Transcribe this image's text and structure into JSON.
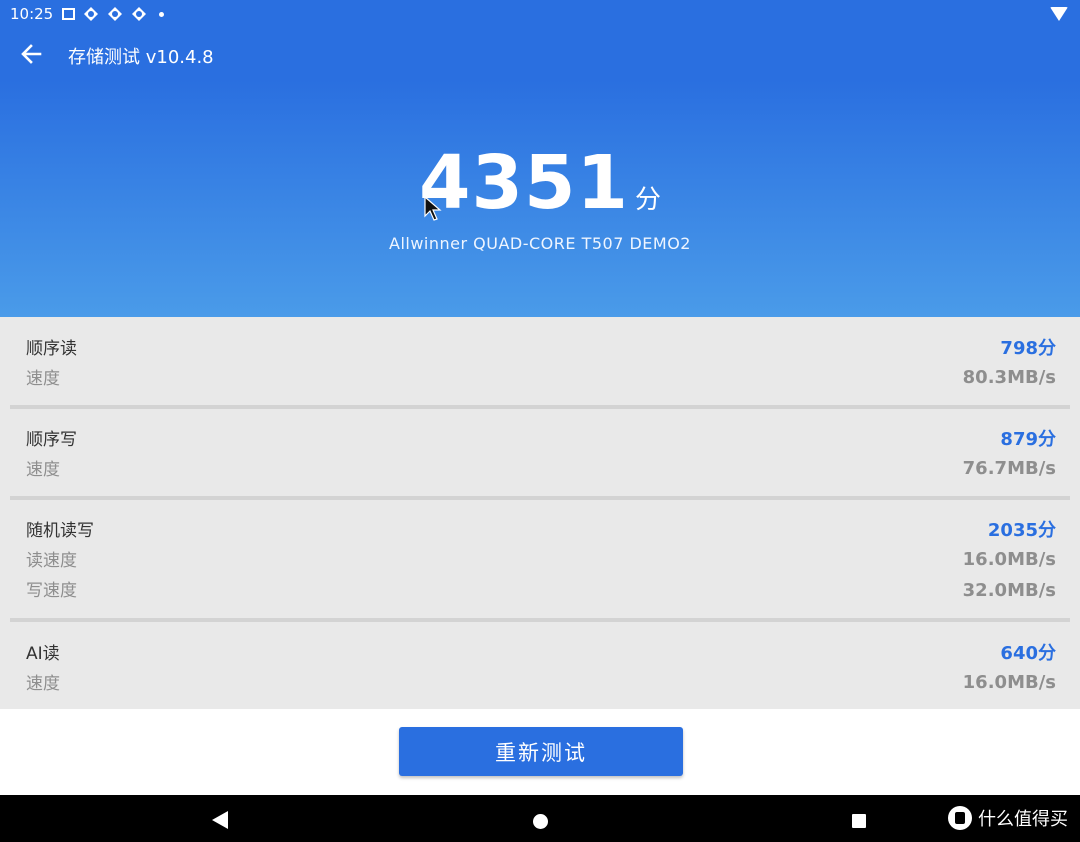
{
  "status": {
    "time": "10:25",
    "icons": [
      "image-icon",
      "sync-icon",
      "sync-icon",
      "sync-icon",
      "dot-icon"
    ],
    "wifi_icon": "wifi-icon"
  },
  "app_bar": {
    "title": "存储测试 v10.4.8",
    "back_icon": "arrow-left-icon"
  },
  "hero": {
    "score": "4351",
    "score_unit": "分",
    "device": "Allwinner QUAD-CORE T507 DEMO2"
  },
  "results": [
    {
      "title": "顺序读",
      "score": "798分",
      "rows": [
        {
          "label": "速度",
          "value": "80.3MB/s"
        }
      ]
    },
    {
      "title": "顺序写",
      "score": "879分",
      "rows": [
        {
          "label": "速度",
          "value": "76.7MB/s"
        }
      ]
    },
    {
      "title": "随机读写",
      "score": "2035分",
      "rows": [
        {
          "label": "读速度",
          "value": "16.0MB/s"
        },
        {
          "label": "写速度",
          "value": "32.0MB/s"
        }
      ]
    },
    {
      "title": "AI读",
      "score": "640分",
      "rows": [
        {
          "label": "速度",
          "value": "16.0MB/s"
        }
      ]
    }
  ],
  "retest_label": "重新测试",
  "watermark": "什么值得买",
  "colors": {
    "primary": "#2a6fe0",
    "hero_bottom": "#4a9be9",
    "panel_bg": "#e9e9e9",
    "muted_text": "#8e8e8e",
    "nav_bg": "#000000"
  }
}
